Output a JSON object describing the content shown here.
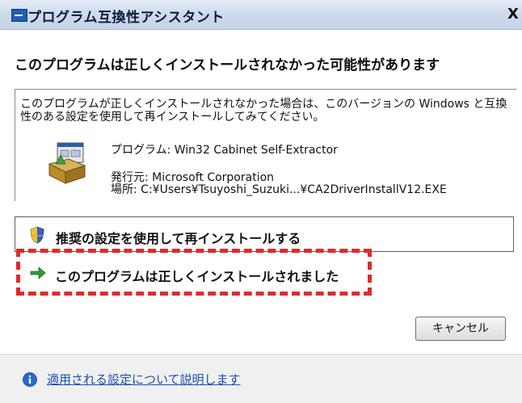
{
  "window": {
    "title": "プログラム互換性アシスタント",
    "close_glyph": "X"
  },
  "main": {
    "title": "このプログラムは正しくインストールされなかった可能性があります",
    "description": "このプログラムが正しくインストールされなかった場合は、このバージョンの Windows と互換性のある設定を使用して再インストールしてみてください。",
    "program_line": "プログラム: Win32 Cabinet Self-Extractor",
    "publisher_line": "発行元: Microsoft Corporation",
    "location_line": "場所: C:¥Users¥Tsuyoshi_Suzuki...¥CA2DriverInstallV12.EXE"
  },
  "options": {
    "reinstall_label": "推奨の設定を使用して再インストールする",
    "installed_ok_label": "このプログラムは正しくインストールされました"
  },
  "buttons": {
    "cancel_label": "キャンセル"
  },
  "footer": {
    "link_label": "適用される設定について説明します"
  },
  "colors": {
    "highlight_border": "#e02a2a",
    "link": "#1a4fb8",
    "arrow_green": "#2e9a3a"
  },
  "icons": {
    "installer": "installer-box-icon",
    "shield": "uac-shield-icon",
    "arrow": "green-arrow-icon",
    "info": "info-icon"
  }
}
